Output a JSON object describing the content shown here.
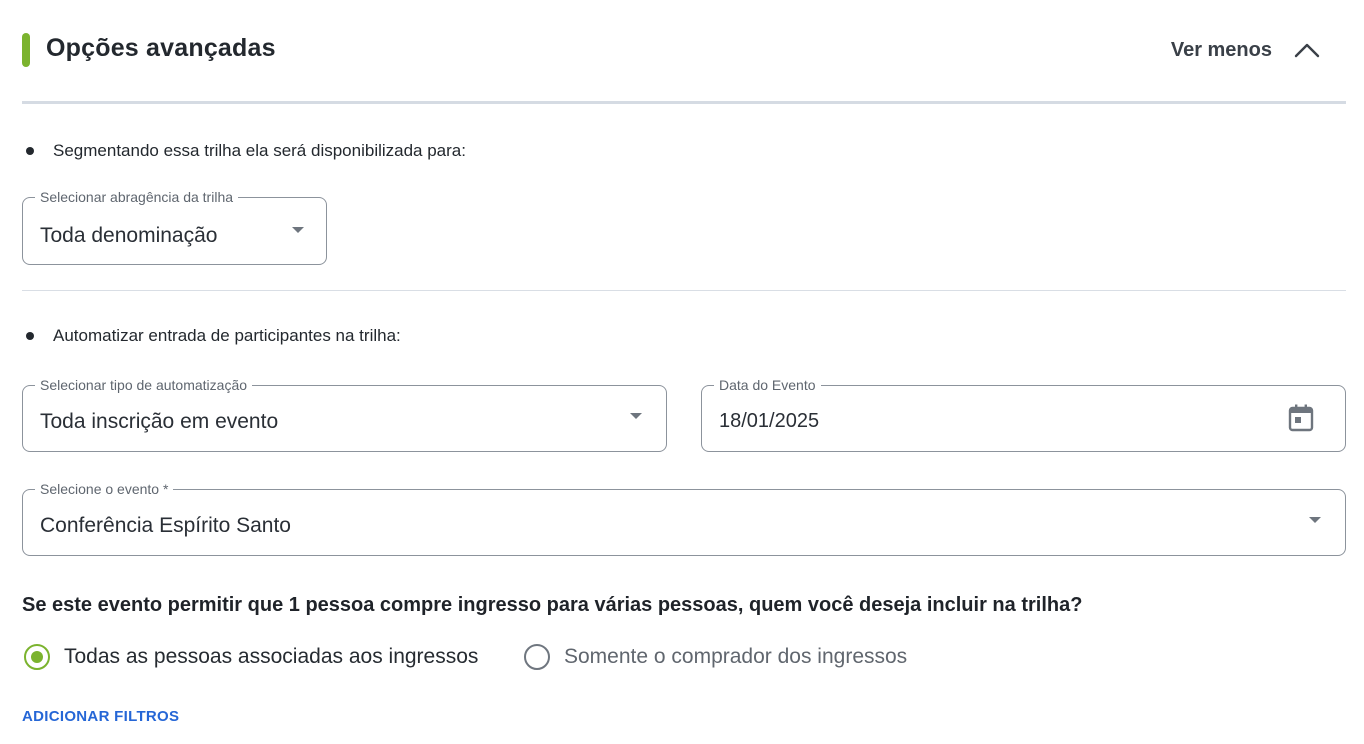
{
  "header": {
    "title": "Opções avançadas",
    "toggle_label": "Ver menos",
    "accent_color": "#7bb32e",
    "toggle_icon": "chevron-up-icon"
  },
  "segment": {
    "bullet_text": "Segmentando essa trilha ela será disponibilizada para:",
    "scope_select": {
      "label": "Selecionar abragência da trilha",
      "value": "Toda denominação",
      "icon": "caret-down-icon"
    }
  },
  "automation": {
    "bullet_text": "Automatizar entrada de participantes na trilha:",
    "type_select": {
      "label": "Selecionar tipo de automatização",
      "value": "Toda inscrição em evento",
      "icon": "caret-down-icon"
    },
    "event_date": {
      "label": "Data do Evento",
      "value": "18/01/2025",
      "icon": "calendar-icon"
    },
    "event_select": {
      "label": "Selecione o evento *",
      "value": "Conferência Espírito Santo",
      "icon": "caret-down-icon"
    }
  },
  "ticket_question": {
    "text": "Se este evento permitir que 1 pessoa compre ingresso para várias pessoas, quem você deseja incluir na trilha?",
    "options": [
      {
        "label": "Todas as pessoas associadas aos ingressos",
        "selected": true
      },
      {
        "label": "Somente o comprador dos ingressos",
        "selected": false
      }
    ],
    "selected_color": "#7bb32e"
  },
  "actions": {
    "add_filters_label": "ADICIONAR FILTROS",
    "link_color": "#2566d6"
  }
}
